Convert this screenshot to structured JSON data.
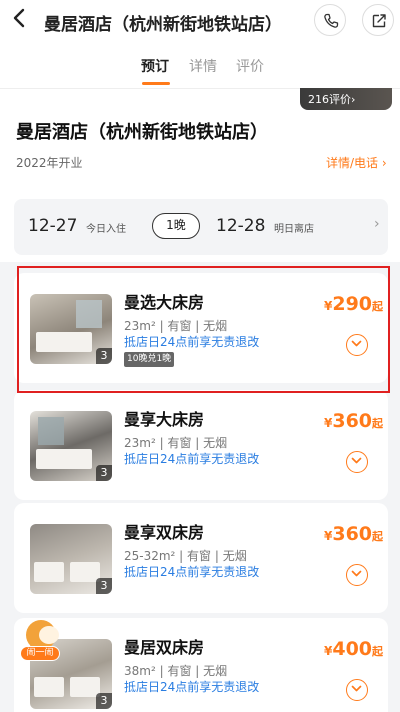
{
  "header": {
    "back_icon": "back-arrow-icon",
    "title": "曼居酒店（杭州新街地铁站店）",
    "phone_icon": "phone-icon",
    "share_icon": "share-icon"
  },
  "tabs": [
    {
      "label": "预订",
      "active": true
    },
    {
      "label": "详情",
      "active": false
    },
    {
      "label": "评价",
      "active": false
    }
  ],
  "reviews_pill": "216评价›",
  "hotel": {
    "name": "曼居酒店（杭州新街地铁站店）",
    "opened": "2022年开业",
    "detail_link": "详情/电话 ›"
  },
  "dates": {
    "checkin_date": "12-27",
    "checkin_label": "今日入住",
    "nights": "1晚",
    "checkout_date": "12-28",
    "checkout_label": "明日离店",
    "chevron": "›"
  },
  "rooms": [
    {
      "name": "曼选大床房",
      "spec": "23m² | 有窗 | 无烟",
      "policy": "抵店日24点前享无责退改",
      "badge": "10晚兑1晚",
      "currency": "¥",
      "price": "290",
      "price_suffix": "起",
      "image_count": "3"
    },
    {
      "name": "曼享大床房",
      "spec": "23m² | 有窗 | 无烟",
      "policy": "抵店日24点前享无责退改",
      "currency": "¥",
      "price": "360",
      "price_suffix": "起",
      "image_count": "3"
    },
    {
      "name": "曼享双床房",
      "spec": "25-32m² | 有窗 | 无烟",
      "policy": "抵店日24点前享无责退改",
      "currency": "¥",
      "price": "360",
      "price_suffix": "起",
      "image_count": "3"
    },
    {
      "name": "曼居双床房",
      "spec": "38m² | 有窗 | 无烟",
      "policy": "抵店日24点前享无责退改",
      "currency": "¥",
      "price": "400",
      "price_suffix": "起",
      "image_count": "3"
    }
  ],
  "mascot_label": "闹一闹",
  "colors": {
    "accent": "#ff7a1a",
    "link_blue": "#2a7de1",
    "highlight_red": "#e02020",
    "list_bg": "#f3f4f6"
  }
}
